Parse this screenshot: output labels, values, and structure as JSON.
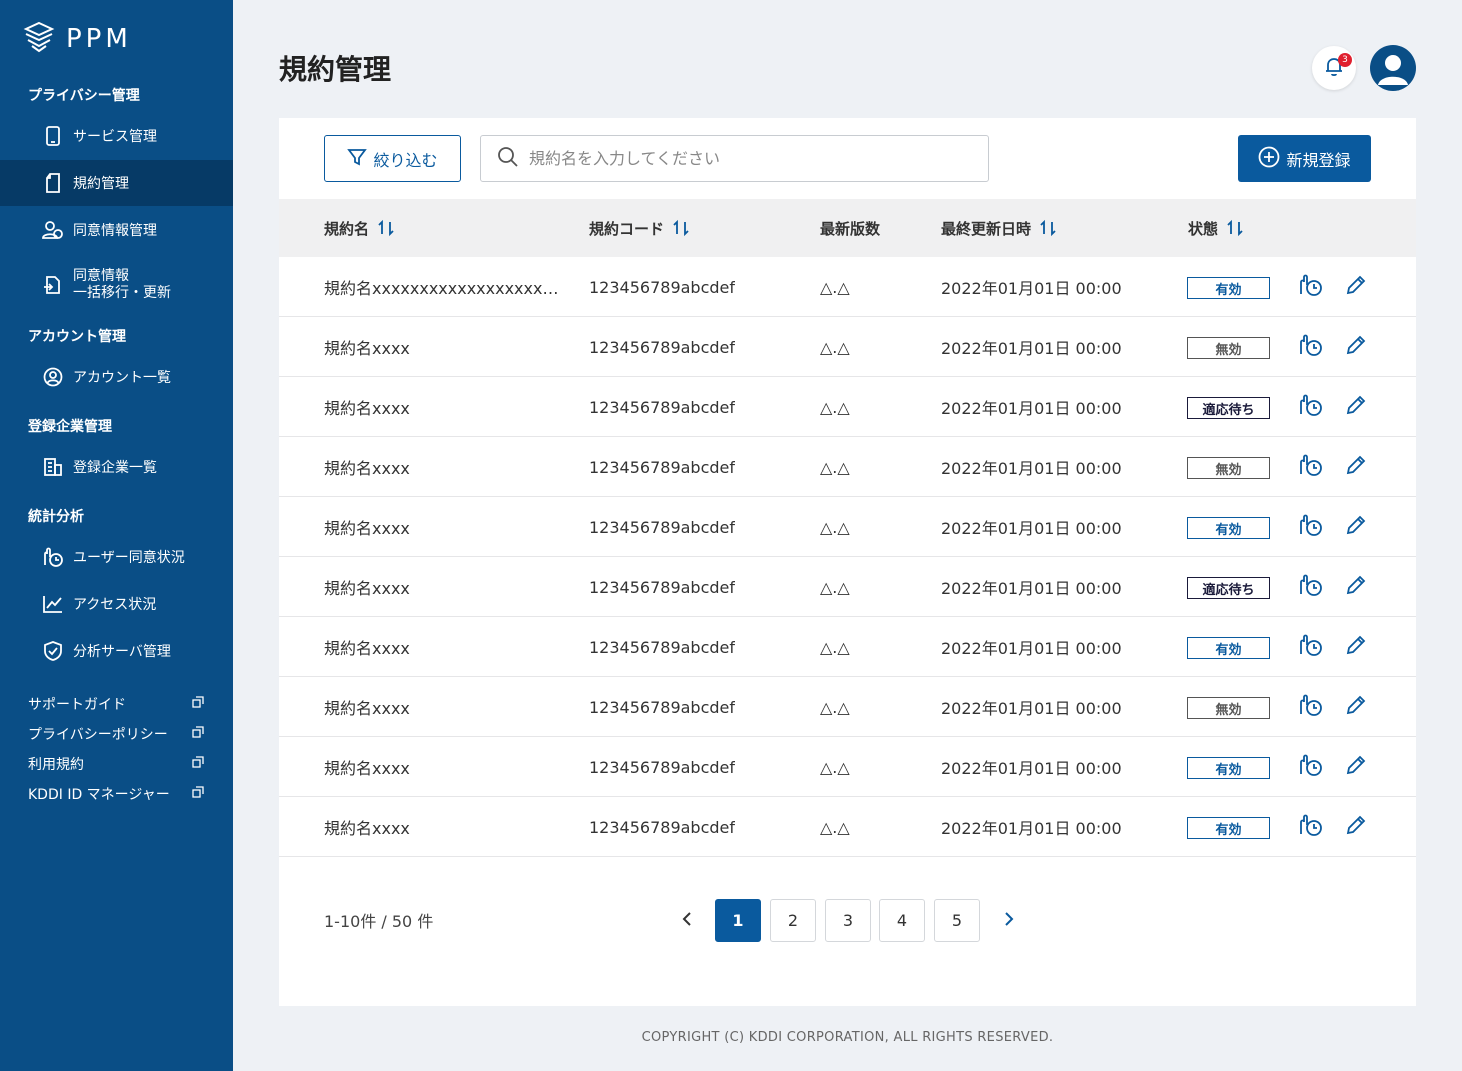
{
  "sidebar": {
    "brand": "PPM",
    "sections": {
      "privacy": "プライバシー管理",
      "account": "アカウント管理",
      "company": "登録企業管理",
      "stats": "統計分析"
    },
    "items": {
      "service": "サービス管理",
      "terms": "規約管理",
      "consent": "同意情報管理",
      "bulk_line1": "同意情報",
      "bulk_line2": "一括移行・更新",
      "account_list": "アカウント一覧",
      "company_list": "登録企業一覧",
      "user_consent": "ユーザー同意状況",
      "access": "アクセス状況",
      "analysis_server": "分析サーバ管理"
    },
    "links": [
      "サポートガイド",
      "プライバシーポリシー",
      "利用規約",
      "KDDI ID マネージャー"
    ]
  },
  "header": {
    "title": "規約管理",
    "notification_count": "3"
  },
  "toolbar": {
    "filter_label": "絞り込む",
    "search_placeholder": "規約名を入力してください",
    "new_label": "新規登録"
  },
  "table": {
    "columns": {
      "name": "規約名",
      "code": "規約コード",
      "version": "最新版数",
      "updated": "最終更新日時",
      "status": "状態"
    },
    "rows": [
      {
        "name": "規約名xxxxxxxxxxxxxxxxxx…",
        "code": "123456789abcdef",
        "version": "△.△",
        "updated": "2022年01月01日 00:00",
        "status": "有効",
        "status_type": "valid"
      },
      {
        "name": "規約名xxxx",
        "code": "123456789abcdef",
        "version": "△.△",
        "updated": "2022年01月01日 00:00",
        "status": "無効",
        "status_type": "invalid"
      },
      {
        "name": "規約名xxxx",
        "code": "123456789abcdef",
        "version": "△.△",
        "updated": "2022年01月01日 00:00",
        "status": "適応待ち",
        "status_type": "pending"
      },
      {
        "name": "規約名xxxx",
        "code": "123456789abcdef",
        "version": "△.△",
        "updated": "2022年01月01日 00:00",
        "status": "無効",
        "status_type": "invalid"
      },
      {
        "name": "規約名xxxx",
        "code": "123456789abcdef",
        "version": "△.△",
        "updated": "2022年01月01日 00:00",
        "status": "有効",
        "status_type": "valid"
      },
      {
        "name": "規約名xxxx",
        "code": "123456789abcdef",
        "version": "△.△",
        "updated": "2022年01月01日 00:00",
        "status": "適応待ち",
        "status_type": "pending"
      },
      {
        "name": "規約名xxxx",
        "code": "123456789abcdef",
        "version": "△.△",
        "updated": "2022年01月01日 00:00",
        "status": "有効",
        "status_type": "valid"
      },
      {
        "name": "規約名xxxx",
        "code": "123456789abcdef",
        "version": "△.△",
        "updated": "2022年01月01日 00:00",
        "status": "無効",
        "status_type": "invalid"
      },
      {
        "name": "規約名xxxx",
        "code": "123456789abcdef",
        "version": "△.△",
        "updated": "2022年01月01日 00:00",
        "status": "有効",
        "status_type": "valid"
      },
      {
        "name": "規約名xxxx",
        "code": "123456789abcdef",
        "version": "△.△",
        "updated": "2022年01月01日 00:00",
        "status": "有効",
        "status_type": "valid"
      }
    ]
  },
  "pagination": {
    "info": "1-10件 / 50 件",
    "pages": [
      "1",
      "2",
      "3",
      "4",
      "5"
    ],
    "current": "1"
  },
  "footer": {
    "copyright": "COPYRIGHT (C) KDDI CORPORATION, ALL RIGHTS RESERVED."
  },
  "colors": {
    "sidebar": "#0a4e86",
    "sidebar_active": "#063a66",
    "primary": "#0a5a9e",
    "badge_alert": "#e0202f"
  }
}
